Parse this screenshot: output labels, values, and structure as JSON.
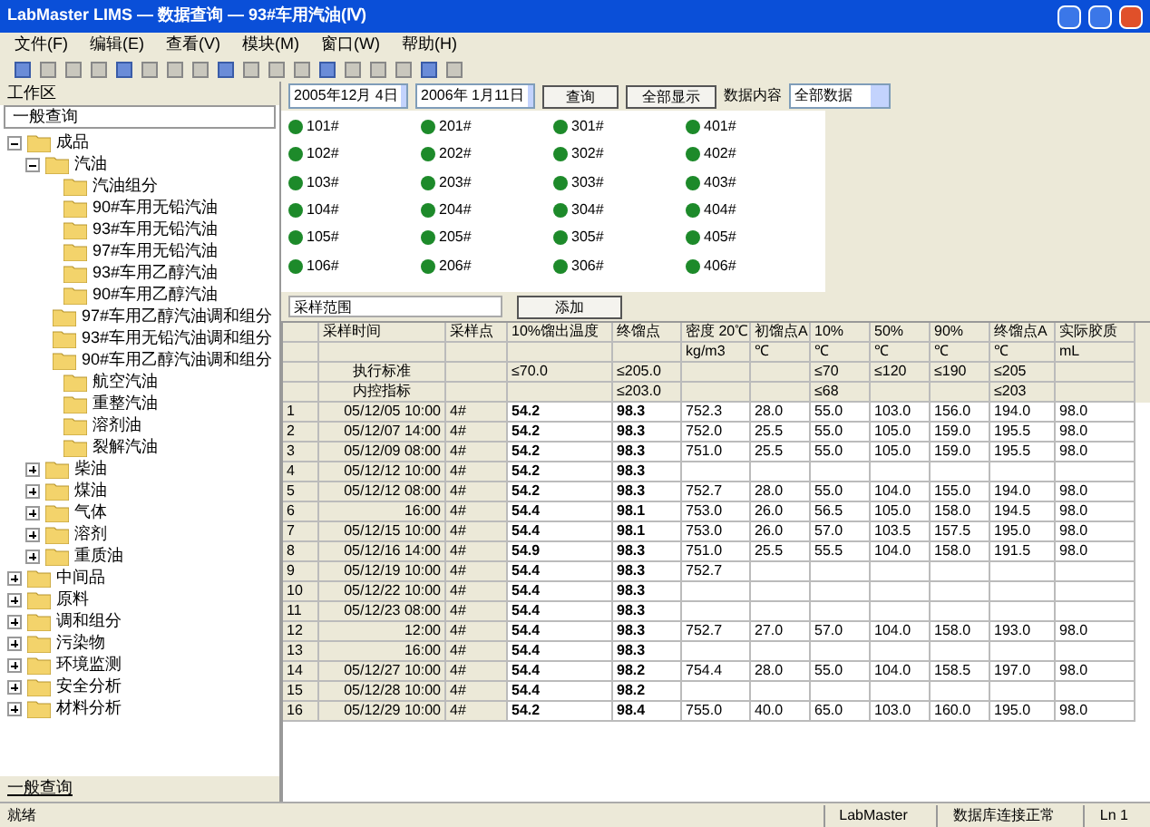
{
  "window": {
    "title": "LabMaster LIMS — 数据查询 — 93#车用汽油(Ⅳ)"
  },
  "menu": [
    "文件(F)",
    "编辑(E)",
    "查看(V)",
    "模块(M)",
    "窗口(W)",
    "帮助(H)"
  ],
  "sidebar": {
    "title": "工作区",
    "dropdown": "一般查询",
    "tree": [
      {
        "label": "成品",
        "expanded": true,
        "children": [
          {
            "label": "汽油",
            "expanded": true,
            "children": [
              {
                "label": "汽油组分"
              },
              {
                "label": "90#车用无铅汽油"
              },
              {
                "label": "93#车用无铅汽油"
              },
              {
                "label": "97#车用无铅汽油"
              },
              {
                "label": "93#车用乙醇汽油"
              },
              {
                "label": "90#车用乙醇汽油"
              },
              {
                "label": "97#车用乙醇汽油调和组分"
              },
              {
                "label": "93#车用无铅汽油调和组分"
              },
              {
                "label": "90#车用乙醇汽油调和组分"
              },
              {
                "label": "航空汽油"
              },
              {
                "label": "重整汽油"
              },
              {
                "label": "溶剂油"
              },
              {
                "label": "裂解汽油"
              }
            ]
          },
          {
            "label": "柴油",
            "expanded": false
          },
          {
            "label": "煤油",
            "expanded": false
          },
          {
            "label": "气体",
            "expanded": false
          },
          {
            "label": "溶剂",
            "expanded": false
          },
          {
            "label": "重质油",
            "expanded": false
          }
        ]
      },
      {
        "label": "中间品",
        "expanded": false
      },
      {
        "label": "原料",
        "expanded": false
      },
      {
        "label": "调和组分",
        "expanded": false
      },
      {
        "label": "污染物",
        "expanded": false
      },
      {
        "label": "环境监测",
        "expanded": false
      },
      {
        "label": "安全分析",
        "expanded": false
      },
      {
        "label": "材料分析",
        "expanded": false
      }
    ],
    "bottom_tab": "一般查询"
  },
  "query": {
    "from": "2005年12月 4日",
    "to": "2006年 1月11日",
    "search_button": "查询",
    "all_button": "全部显示",
    "display_label": "数据内容",
    "display_value": "全部数据"
  },
  "sample_points": [
    "101#",
    "102#",
    "103#",
    "104#",
    "105#",
    "106#",
    "201#",
    "202#",
    "203#",
    "204#",
    "205#",
    "206#",
    "301#",
    "302#",
    "303#",
    "304#",
    "305#",
    "306#",
    "401#",
    "402#",
    "403#",
    "404#",
    "405#",
    "406#"
  ],
  "filter": {
    "label": "采样范围",
    "button": "添加"
  },
  "table": {
    "columns": [
      {
        "label": "采样时间"
      },
      {
        "label": "采样点"
      },
      {
        "label": "10%馏出温度"
      },
      {
        "label": "终馏点"
      },
      {
        "label": "密度 20℃",
        "unit": "kg/m3"
      },
      {
        "label": "初馏点A",
        "unit": "℃"
      },
      {
        "label": "10%",
        "unit": "℃"
      },
      {
        "label": "50%",
        "unit": "℃"
      },
      {
        "label": "90%",
        "unit": "℃"
      },
      {
        "label": "终馏点A",
        "unit": "℃"
      },
      {
        "label": "实际胶质",
        "unit": "mL"
      }
    ],
    "limits": [
      {
        "label": "执行标准",
        "cells": [
          null,
          "≤70.0",
          "≤205.0",
          null,
          null,
          "≤70",
          "≤120",
          "≤190",
          "≤205",
          null
        ]
      },
      {
        "label": "内控指标",
        "cells": [
          null,
          null,
          "≤203.0",
          null,
          null,
          "≤68",
          null,
          null,
          "≤203",
          null
        ]
      }
    ],
    "rows": [
      {
        "number": "1",
        "cells": [
          "05/12/05 10:00",
          "4#",
          "54.2",
          "98.3",
          "752.3",
          "28.0",
          "55.0",
          "103.0",
          "156.0",
          "194.0",
          "98.0"
        ]
      },
      {
        "number": "2",
        "cells": [
          "05/12/07 14:00",
          "4#",
          "54.2",
          "98.3",
          "752.0",
          "25.5",
          "55.0",
          "105.0",
          "159.0",
          "195.5",
          "98.0"
        ]
      },
      {
        "number": "3",
        "cells": [
          "05/12/09 08:00",
          "4#",
          "54.2",
          "98.3",
          "751.0",
          "25.5",
          "55.0",
          "105.0",
          "159.0",
          "195.5",
          "98.0"
        ]
      },
      {
        "number": "4",
        "cells": [
          "05/12/12 10:00",
          "4#",
          "54.2",
          "98.3",
          null,
          null,
          null,
          null,
          null,
          null,
          null
        ]
      },
      {
        "number": "5",
        "cells": [
          "05/12/12 08:00",
          "4#",
          "54.2",
          "98.3",
          "752.7",
          "28.0",
          "55.0",
          "104.0",
          "155.0",
          "194.0",
          "98.0"
        ]
      },
      {
        "number": "6",
        "cells": [
          "16:00",
          "4#",
          "54.4",
          "98.1",
          "753.0",
          "26.0",
          "56.5",
          "105.0",
          "158.0",
          "194.5",
          "98.0"
        ]
      },
      {
        "number": "7",
        "cells": [
          "05/12/15 10:00",
          "4#",
          "54.4",
          "98.1",
          "753.0",
          "26.0",
          "57.0",
          "103.5",
          "157.5",
          "195.0",
          "98.0"
        ]
      },
      {
        "number": "8",
        "cells": [
          "05/12/16 14:00",
          "4#",
          "54.9",
          "98.3",
          "751.0",
          "25.5",
          "55.5",
          "104.0",
          "158.0",
          "191.5",
          "98.0"
        ]
      },
      {
        "number": "9",
        "cells": [
          "05/12/19 10:00",
          "4#",
          "54.4",
          "98.3",
          "752.7",
          null,
          null,
          null,
          null,
          null,
          null
        ]
      },
      {
        "number": "10",
        "cells": [
          "05/12/22 10:00",
          "4#",
          "54.4",
          "98.3",
          null,
          null,
          null,
          null,
          null,
          null,
          null
        ]
      },
      {
        "number": "11",
        "cells": [
          "05/12/23 08:00",
          "4#",
          "54.4",
          "98.3",
          null,
          null,
          null,
          null,
          null,
          null,
          null
        ]
      },
      {
        "number": "12",
        "cells": [
          "12:00",
          "4#",
          "54.4",
          "98.3",
          "752.7",
          "27.0",
          "57.0",
          "104.0",
          "158.0",
          "193.0",
          "98.0"
        ]
      },
      {
        "number": "13",
        "cells": [
          "16:00",
          "4#",
          "54.4",
          "98.3",
          null,
          null,
          null,
          null,
          null,
          null,
          null
        ]
      },
      {
        "number": "14",
        "cells": [
          "05/12/27 10:00",
          "4#",
          "54.4",
          "98.2",
          "754.4",
          "28.0",
          "55.0",
          "104.0",
          "158.5",
          "197.0",
          "98.0"
        ]
      },
      {
        "number": "15",
        "cells": [
          "05/12/28 10:00",
          "4#",
          "54.4",
          "98.2",
          null,
          null,
          null,
          null,
          null,
          null,
          null
        ]
      },
      {
        "number": "16",
        "cells": [
          "05/12/29 10:00",
          "4#",
          "54.2",
          "98.4",
          "755.0",
          "40.0",
          "65.0",
          "103.0",
          "160.0",
          "195.0",
          "98.0"
        ]
      }
    ]
  },
  "status_bar": {
    "left": "就绪",
    "items": [
      "LabMaster",
      "数据库连接正常",
      "Ln 1"
    ]
  }
}
